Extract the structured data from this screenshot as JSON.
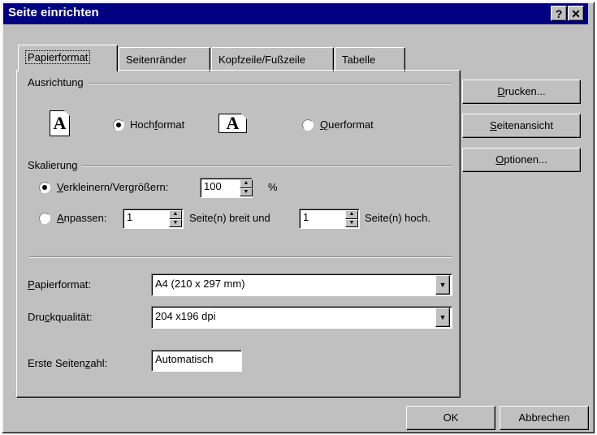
{
  "window": {
    "title": "Seite einrichten",
    "help_label": "?",
    "close_label": "✕"
  },
  "tabs": [
    {
      "label": "Papierformat"
    },
    {
      "label": "Seitenränder"
    },
    {
      "label": "Kopfzeile/Fußzeile"
    },
    {
      "label": "Tabelle"
    }
  ],
  "orientation": {
    "group_label": "Ausrichtung",
    "portrait_label_pre": "Hoch",
    "portrait_label_u": "f",
    "portrait_label_post": "ormat",
    "landscape_label_u": "Q",
    "landscape_label_post": "uerformat",
    "portrait_icon": "A",
    "landscape_icon": "A",
    "selected": "portrait"
  },
  "scaling": {
    "group_label": "Skalierung",
    "reduce_label_u": "V",
    "reduce_label_post": "erkleinern/Vergrößern:",
    "reduce_value": "100",
    "percent_label": "%",
    "fit_label_u": "A",
    "fit_label_post": "npassen:",
    "fit_wide_value": "1",
    "fit_wide_label": "Seite(n) breit und",
    "fit_tall_value": "1",
    "fit_tall_label": "Seite(n) hoch.",
    "selected": "reduce"
  },
  "paper": {
    "size_label_u": "P",
    "size_label_post": "apierformat:",
    "size_value": "A4 (210 x 297 mm)",
    "quality_label_pre": "Dru",
    "quality_label_u": "c",
    "quality_label_post": "kqualität:",
    "quality_value": "204 x196 dpi",
    "first_page_label_pre": "Erste Seiten",
    "first_page_label_u": "z",
    "first_page_label_post": "ahl:",
    "first_page_value": "Automatisch"
  },
  "side_buttons": {
    "print_u": "D",
    "print_post": "rucken...",
    "preview_u": "S",
    "preview_post": "eitenansicht",
    "options_u": "O",
    "options_post": "ptionen..."
  },
  "footer": {
    "ok_label": "OK",
    "cancel_label": "Abbrechen"
  },
  "icons": {
    "dropdown_arrow": "▼",
    "spin_up": "▲",
    "spin_down": "▼"
  }
}
